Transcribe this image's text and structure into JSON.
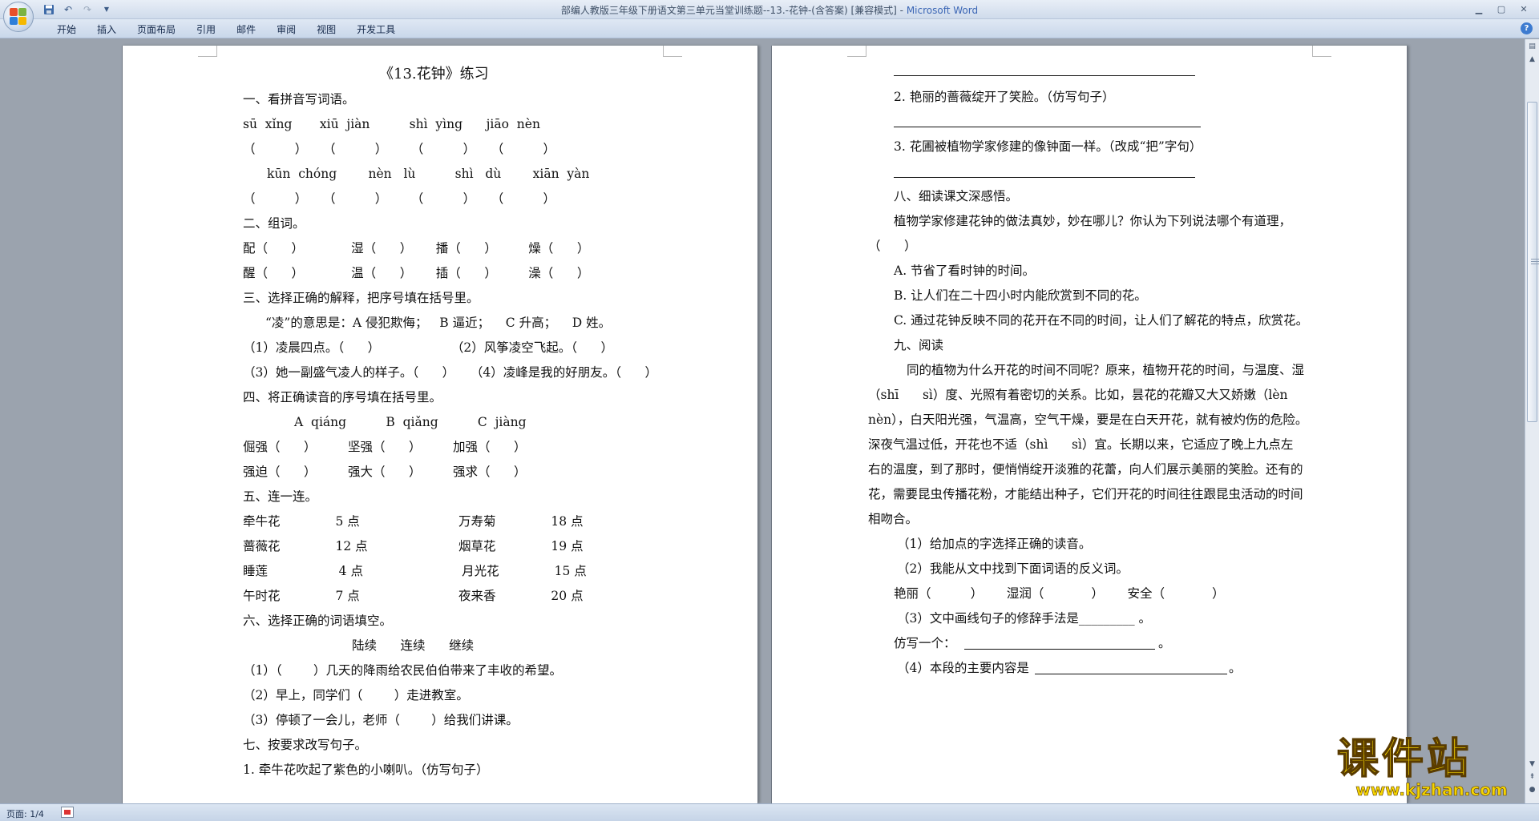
{
  "window": {
    "title": "部编人教版三年级下册语文第三单元当堂训练题--13.-花钟-(含答案) [兼容模式] - ",
    "app_name": "Microsoft Word"
  },
  "ribbon": {
    "tabs": [
      "开始",
      "插入",
      "页面布局",
      "引用",
      "邮件",
      "审阅",
      "视图",
      "开发工具"
    ]
  },
  "page1": {
    "lines": [
      "《13.花钟》练习",
      "一、看拼音写词语。",
      "sū  xǐng       xiū  jiàn          shì  yìng      jiāo  nèn",
      "（          ）    （          ）      （          ）    （          ）",
      "kūn  chóng        nèn   lù          shì   dù        xiān  yàn",
      "（          ）    （          ）      （          ）    （          ）",
      "二、组词。",
      "配（      ）            湿（      ）      播（      ）        燥（      ）",
      "醒（      ）            温（      ）      插（      ）        澡（      ）",
      "三、选择正确的解释，把序号填在括号里。",
      "“凌”的意思是：A 侵犯欺侮；   B 逼近；    C 升高；    D 姓。",
      "（1）凌晨四点。（      ）                  （2）风筝凌空飞起。（      ）",
      "（3）她一副盛气凌人的样子。（      ）    （4）凌峰是我的好朋友。（      ）",
      "四、将正确读音的序号填在括号里。",
      "A  qiáng          B  qiǎng          C  jiàng",
      "倔强（      ）        坚强（      ）        加强（      ）",
      "强迫（      ）        强大（      ）        强求（      ）",
      "五、连一连。",
      "牵牛花              5 点                         万寿菊              18 点",
      "蔷薇花              12 点                       烟草花              19 点",
      "睡莲                  4 点                         月光花              15 点",
      "午时花              7 点                         夜来香              20 点",
      "六、选择正确的词语填空。",
      "陆续      连续      继续",
      "（1）（        ）几天的降雨给农民伯伯带来了丰收的希望。",
      "（2）早上，同学们（        ）走进教室。",
      "（3）停顿了一会儿，老师（        ）给我们讲课。",
      "七、按要求改写句子。",
      "1. 牵牛花吹起了紫色的小喇叭。（仿写句子）"
    ]
  },
  "page2": {
    "lines": [
      "2. 艳丽的蔷薇绽开了笑脸。（仿写句子）",
      "3. 花圃被植物学家修建的像钟面一样。（改成“把”字句）",
      "八、细读课文深感悟。",
      "植物学家修建花钟的做法真妙，妙在哪儿？你认为下列说法哪个有道理，",
      "（      ）",
      "A. 节省了看时钟的时间。",
      "B. 让人们在二十四小时内能欣赏到不同的花。",
      "C. 通过花钟反映不同的花开在不同的时间，让人们了解花的特点，欣赏花。",
      "九、阅读",
      "同的植物为什么开花的时间不同呢？原来，植物开花的时间，与温度、湿",
      "（shī      sì）度、光照有着密切的关系。比如，昙花的花瓣又大又娇嫩（lèn",
      "nèn），白天阳光强，气温高，空气干燥，要是在白天开花，就有被灼伤的危险。",
      "深夜气温过低，开花也不适（shì      sì）宜。长期以来，它适应了晚上九点左",
      "右的温度，到了那时，便悄悄绽开淡雅的花蕾，向人们展示美丽的笑脸。还有的",
      "花，需要昆虫传播花粉，才能结出种子，它们开花的时间往往跟昆虫活动的时间",
      "相吻合。",
      "（1）给加点的字选择正确的读音。",
      "（2）我能从文中找到下面词语的反义词。",
      "艳丽（          ）      湿润（            ）      安全（            ）",
      "（3）文中画线句子的修辞手法是_________ 。",
      "仿写一个：",
      "（4）本段的主要内容是 "
    ]
  },
  "statusbar": {
    "page_info": "页面: 1/4"
  },
  "watermark": {
    "main": "课件站",
    "sub": "www.kjzhan.com"
  },
  "colors": {
    "title_app": "#3b66b5",
    "doc_background": "#9ba3ae",
    "watermark": "#f5d400"
  }
}
